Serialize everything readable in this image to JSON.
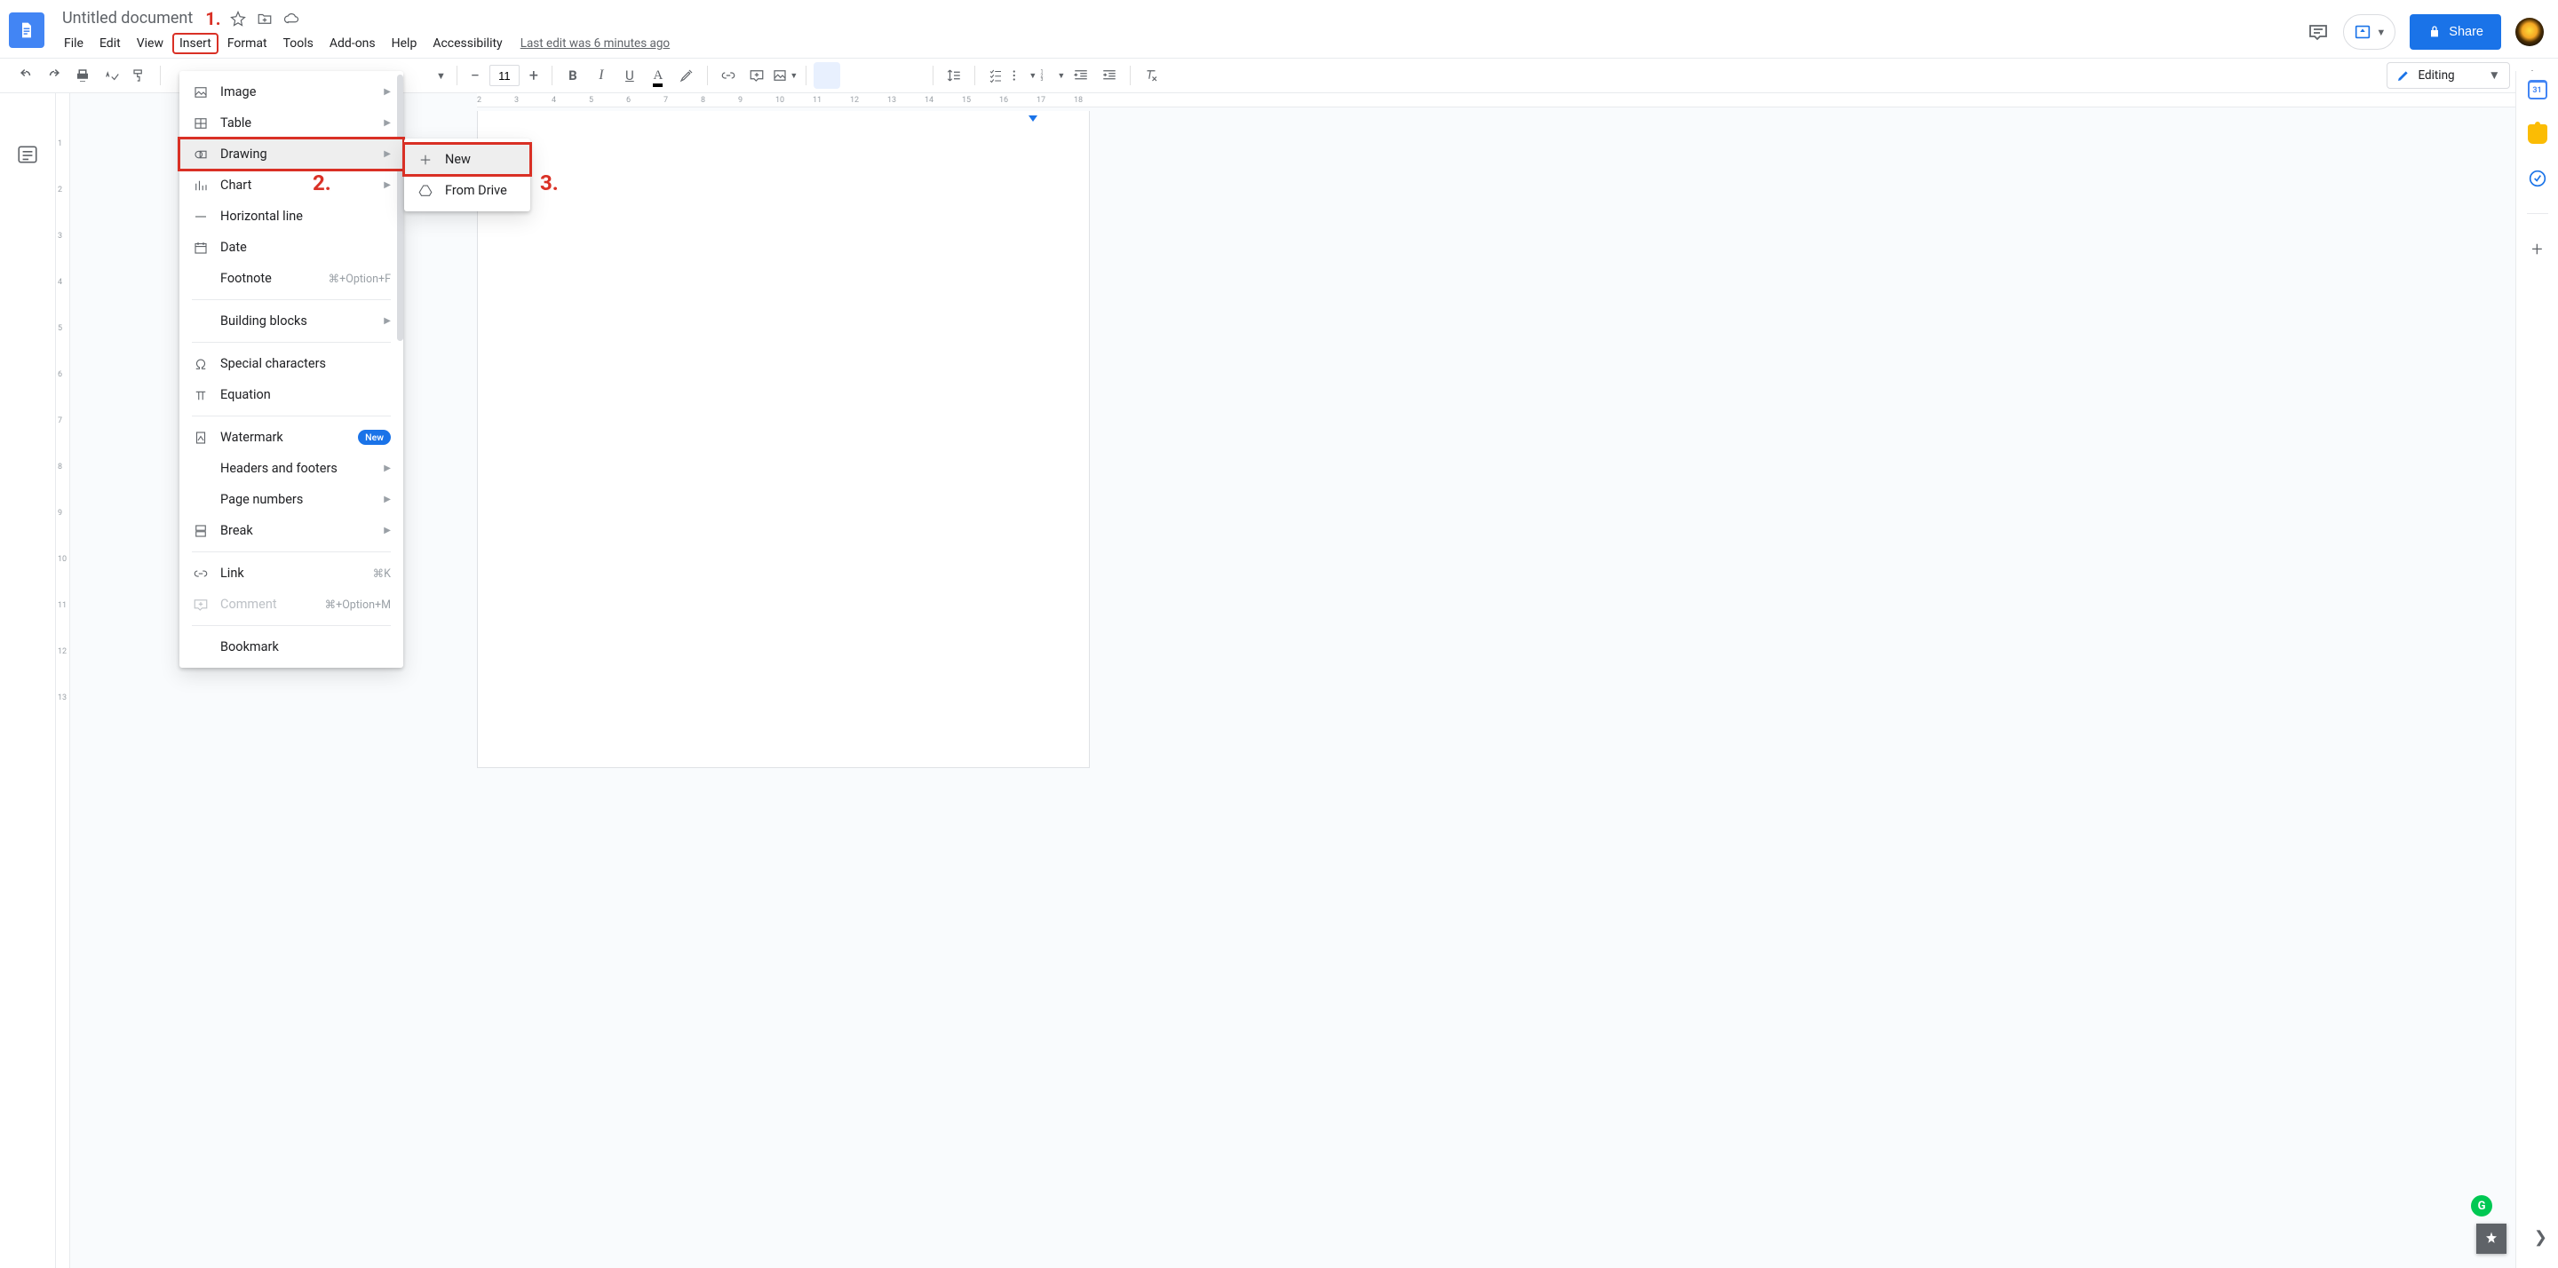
{
  "doc_title": "Untitled document",
  "menus": [
    "File",
    "Edit",
    "View",
    "Insert",
    "Format",
    "Tools",
    "Add-ons",
    "Help",
    "Accessibility"
  ],
  "last_edit": "Last edit was 6 minutes ago",
  "share_label": "Share",
  "font_size": "11",
  "editing_mode": "Editing",
  "annotations": {
    "a1": "1.",
    "a2": "2.",
    "a3": "3."
  },
  "insert_menu": {
    "image": "Image",
    "table": "Table",
    "drawing": "Drawing",
    "chart": "Chart",
    "hline": "Horizontal line",
    "date": "Date",
    "footnote": "Footnote",
    "footnote_sc": "⌘+Option+F",
    "blocks": "Building blocks",
    "special": "Special characters",
    "equation": "Equation",
    "watermark": "Watermark",
    "new_badge": "New",
    "headers": "Headers and footers",
    "pnum": "Page numbers",
    "break": "Break",
    "link": "Link",
    "link_sc": "⌘K",
    "comment": "Comment",
    "comment_sc": "⌘+Option+M",
    "bookmark": "Bookmark"
  },
  "submenu": {
    "new": "New",
    "from_drive": "From Drive"
  },
  "ruler_h": [
    "2",
    "3",
    "4",
    "5",
    "6",
    "7",
    "8",
    "9",
    "10",
    "11",
    "12",
    "13",
    "14",
    "15",
    "16",
    "17",
    "18"
  ],
  "ruler_v": [
    "",
    "1",
    "2",
    "3",
    "4",
    "5",
    "6",
    "7",
    "8",
    "9",
    "10",
    "11",
    "12",
    "13"
  ]
}
